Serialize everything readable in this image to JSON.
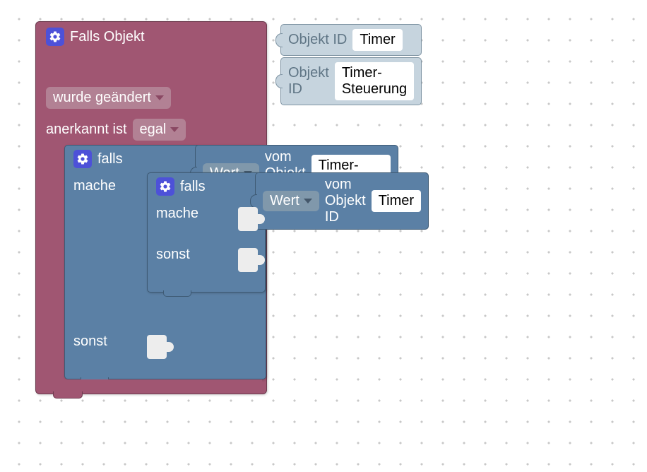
{
  "event_block": {
    "title": "Falls Objekt",
    "inputs": {
      "objekt_id_label": "Objekt ID",
      "id1": "Timer",
      "id2": "Timer-Steuerung"
    },
    "condition_dropdown": "wurde geändert",
    "ack_label": "anerkannt ist",
    "ack_dropdown": "egal"
  },
  "outer_if": {
    "falls": "falls",
    "mache": "mache",
    "sonst": "sonst",
    "value_block": {
      "wert": "Wert",
      "vom": "vom Objekt ID",
      "id": "Timer-Steuerung"
    }
  },
  "inner_if": {
    "falls": "falls",
    "mache": "mache",
    "sonst": "sonst",
    "value_block": {
      "wert": "Wert",
      "vom": "vom Objekt ID",
      "id": "Timer"
    }
  }
}
